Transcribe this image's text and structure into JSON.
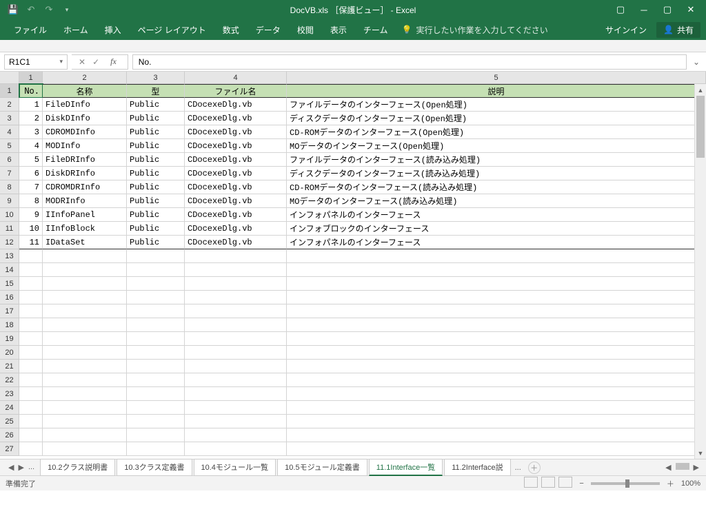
{
  "app": {
    "title": "DocVB.xls ［保護ビュー］ - Excel",
    "status": "準備完了",
    "zoom": "100%"
  },
  "ribbon": {
    "tabs": [
      "ファイル",
      "ホーム",
      "挿入",
      "ページ レイアウト",
      "数式",
      "データ",
      "校閲",
      "表示",
      "チーム"
    ],
    "tell_me": "実行したい作業を入力してください",
    "signin": "サインイン",
    "share": "共有"
  },
  "namebox": "R1C1",
  "formula": "No.",
  "col_headers": [
    "1",
    "2",
    "3",
    "4",
    "5"
  ],
  "table": {
    "headers": [
      "No.",
      "名称",
      "型",
      "ファイル名",
      "説明"
    ],
    "rows": [
      [
        "1",
        "FileDInfo",
        "Public",
        "CDocexeDlg.vb",
        "ファイルデータのインターフェース(Open処理)"
      ],
      [
        "2",
        "DiskDInfo",
        "Public",
        "CDocexeDlg.vb",
        "ディスクデータのインターフェース(Open処理)"
      ],
      [
        "3",
        "CDROMDInfo",
        "Public",
        "CDocexeDlg.vb",
        "CD-ROMデータのインターフェース(Open処理)"
      ],
      [
        "4",
        "MODInfo",
        "Public",
        "CDocexeDlg.vb",
        "MOデータのインターフェース(Open処理)"
      ],
      [
        "5",
        "FileDRInfo",
        "Public",
        "CDocexeDlg.vb",
        "ファイルデータのインターフェース(読み込み処理)"
      ],
      [
        "6",
        "DiskDRInfo",
        "Public",
        "CDocexeDlg.vb",
        "ディスクデータのインターフェース(読み込み処理)"
      ],
      [
        "7",
        "CDROMDRInfo",
        "Public",
        "CDocexeDlg.vb",
        "CD-ROMデータのインターフェース(読み込み処理)"
      ],
      [
        "8",
        "MODRInfo",
        "Public",
        "CDocexeDlg.vb",
        "MOデータのインターフェース(読み込み処理)"
      ],
      [
        "9",
        "IInfoPanel",
        "Public",
        "CDocexeDlg.vb",
        "インフォパネルのインターフェース"
      ],
      [
        "10",
        "IInfoBlock",
        "Public",
        "CDocexeDlg.vb",
        "インフォブロックのインターフェース"
      ],
      [
        "11",
        "IDataSet",
        "Public",
        "CDocexeDlg.vb",
        "インフォパネルのインターフェース"
      ]
    ]
  },
  "sheets": {
    "ellipsis": "...",
    "tabs": [
      "10.2クラス説明書",
      "10.3クラス定義書",
      "10.4モジュール一覧",
      "10.5モジュール定義書",
      "11.1Interface一覧",
      "11.2Interface説"
    ],
    "active_index": 4,
    "more": "..."
  }
}
